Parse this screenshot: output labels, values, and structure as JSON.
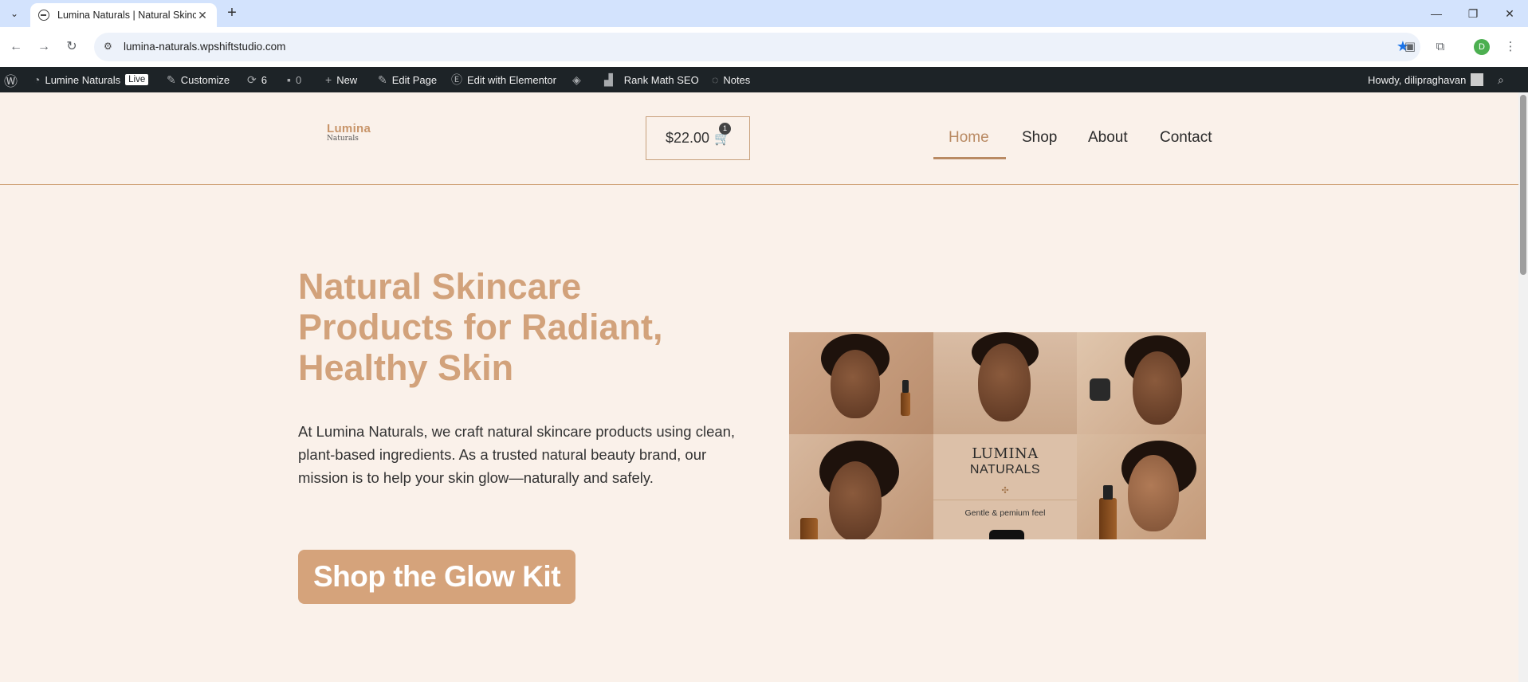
{
  "browser": {
    "tab_title": "Lumina Naturals | Natural Skinc",
    "url": "lumina-naturals.wpshiftstudio.com",
    "profile_initial": "D"
  },
  "admin_bar": {
    "site_name": "Lumine Naturals",
    "live_badge": "Live",
    "customize": "Customize",
    "updates_count": "6",
    "comments_count": "0",
    "new": "New",
    "edit_page": "Edit Page",
    "edit_elementor": "Edit with Elementor",
    "rank_math": "Rank Math SEO",
    "notes": "Notes",
    "howdy": "Howdy, dilipraghavan"
  },
  "header": {
    "logo_line1": "Lumina",
    "logo_line2": "Naturals",
    "cart_total": "$22.00",
    "cart_count": "1",
    "nav": [
      {
        "label": "Home",
        "active": true
      },
      {
        "label": "Shop"
      },
      {
        "label": "About"
      },
      {
        "label": "Contact"
      }
    ]
  },
  "hero": {
    "title": "Natural Skincare Products for Radiant, Healthy Skin",
    "text": "At Lumina Naturals, we craft natural skincare products using clean, plant-based ingredients. As a trusted natural beauty brand, our mission is to help your skin glow—naturally and safely.",
    "cta": "Shop the Glow Kit"
  },
  "collage": {
    "brand_line1": "LUMINA",
    "brand_line2": "NATURALS",
    "tagline": "Gentle & pemium feel"
  },
  "colors": {
    "accent": "#d5a37b",
    "page_bg": "#faf1ea",
    "admin_bar": "#1d2327"
  }
}
